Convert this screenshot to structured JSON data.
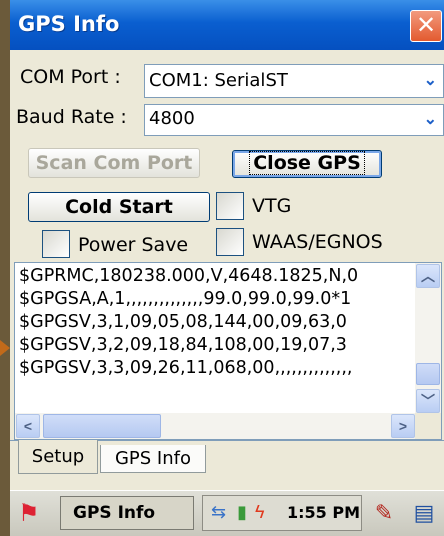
{
  "window": {
    "title": "GPS Info",
    "close_label": "✕"
  },
  "com_port": {
    "label": "COM Port :",
    "value": "COM1:  SerialST"
  },
  "baud_rate": {
    "label": "Baud Rate :",
    "value": "4800"
  },
  "buttons": {
    "scan": "Scan Com Port",
    "close_gps": "Close GPS",
    "cold_start": "Cold Start"
  },
  "checkboxes": {
    "vtg": "VTG",
    "power_save": "Power Save",
    "waas": "WAAS/EGNOS"
  },
  "nmea": {
    "lines": [
      "$GPRMC,180238.000,V,4648.1825,N,0",
      "$GPGSA,A,1,,,,,,,,,,,,,,99.0,99.0,99.0*1",
      "$GPGSV,3,1,09,05,08,144,00,09,63,0",
      "$GPGSV,3,2,09,18,84,108,00,19,07,3",
      "$GPGSV,3,3,09,26,11,068,00,,,,,,,,,,,,,,"
    ]
  },
  "tabs": [
    {
      "label": "Setup"
    },
    {
      "label": "GPS Info"
    }
  ],
  "taskbar": {
    "task_label": "GPS Info",
    "clock": "1:55 PM"
  },
  "icons": {
    "start": "windows-flag-icon",
    "combo_arrow": "chevron-down-icon",
    "network": "network-icon",
    "battery": "battery-icon",
    "edit": "edit-icon",
    "keyboard": "input-panel-icon"
  },
  "colors": {
    "titlebar": "#0a5fd0",
    "close": "#e35a2f",
    "window_bg": "#ece9d8"
  }
}
